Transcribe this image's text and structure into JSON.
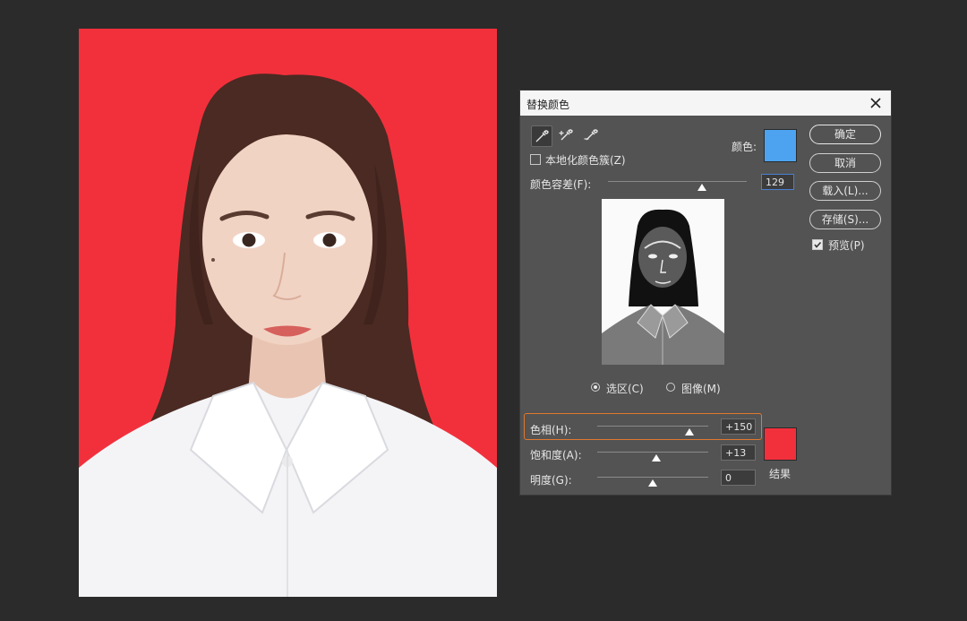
{
  "dialog": {
    "title": "替换颜色",
    "color_label": "颜色:",
    "localized_clusters_label": "本地化颜色簇(Z)",
    "localized_clusters_checked": false,
    "fuzziness_label": "颜色容差(F):",
    "fuzziness_value": "129",
    "fuzziness_level": 0.68,
    "selection_radio_label": "选区(C)",
    "image_radio_label": "图像(M)",
    "view_mode": "selection",
    "source_color": "#4da3f0",
    "tools": [
      "eyedropper-icon",
      "eyedropper-plus-icon",
      "eyedropper-minus-icon"
    ],
    "close_icon": "close-icon"
  },
  "buttons": {
    "ok": "确定",
    "cancel": "取消",
    "load": "载入(L)...",
    "save": "存储(S)...",
    "preview_label": "预览(P)",
    "preview_checked": true
  },
  "replacement": {
    "hue_label": "色相(H):",
    "hue_value": "+150",
    "hue_level": 0.83,
    "saturation_label": "饱和度(A):",
    "saturation_value": "+13",
    "saturation_level": 0.53,
    "lightness_label": "明度(G):",
    "lightness_value": "0",
    "lightness_level": 0.5,
    "result_label": "结果",
    "result_color": "#f2303c"
  },
  "colors": {
    "photo_background": "#f2303c",
    "dialog_background": "#535353",
    "highlight": "#e0782e"
  }
}
